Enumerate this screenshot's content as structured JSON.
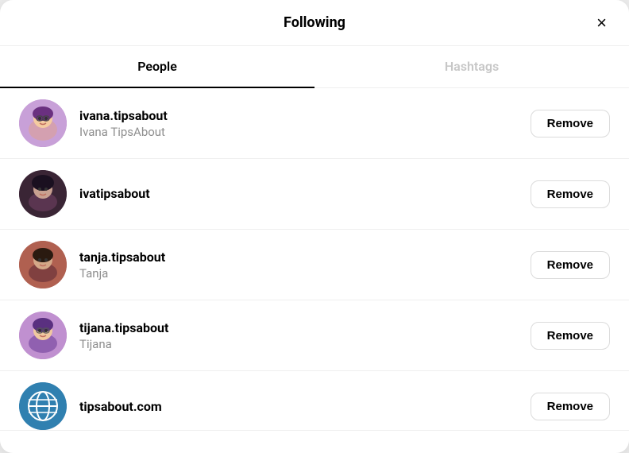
{
  "modal": {
    "title": "Following",
    "close_label": "×"
  },
  "tabs": [
    {
      "id": "people",
      "label": "People",
      "active": true
    },
    {
      "id": "hashtags",
      "label": "Hashtags",
      "active": false
    }
  ],
  "users": [
    {
      "id": 1,
      "username": "ivana.tipsabout",
      "display_name": "Ivana TipsAbout",
      "avatar_class": "avatar-1",
      "avatar_emoji": "👩",
      "remove_label": "Remove"
    },
    {
      "id": 2,
      "username": "ivatipsabout",
      "display_name": "",
      "avatar_class": "avatar-2",
      "avatar_emoji": "👩",
      "remove_label": "Remove"
    },
    {
      "id": 3,
      "username": "tanja.tipsabout",
      "display_name": "Tanja",
      "avatar_class": "avatar-3",
      "avatar_emoji": "👩",
      "remove_label": "Remove"
    },
    {
      "id": 4,
      "username": "tijana.tipsabout",
      "display_name": "Tijana",
      "avatar_class": "avatar-4",
      "avatar_emoji": "👩",
      "remove_label": "Remove"
    },
    {
      "id": 5,
      "username": "tipsabout.com",
      "display_name": "",
      "avatar_class": "avatar-5",
      "avatar_emoji": "🌐",
      "remove_label": "Remove"
    }
  ]
}
